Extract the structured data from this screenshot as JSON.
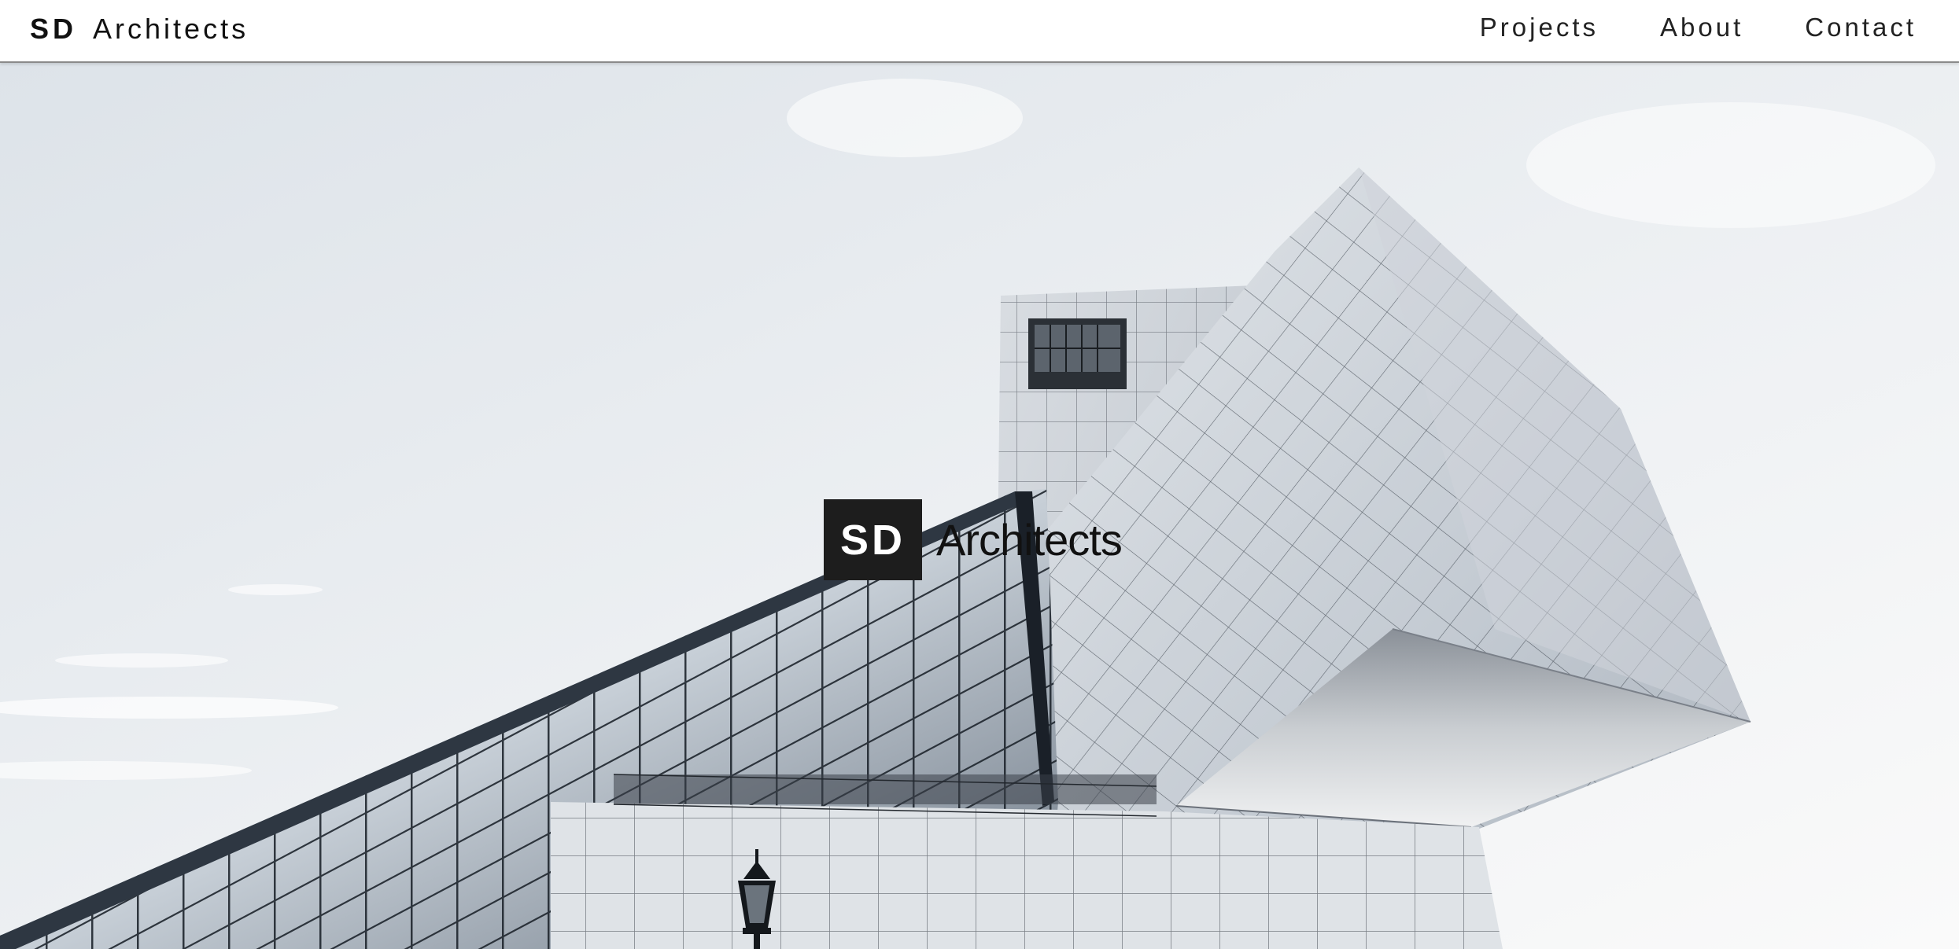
{
  "header": {
    "brand_bold": "SD",
    "brand_rest": "Architects",
    "nav": [
      {
        "label": "Projects"
      },
      {
        "label": "About"
      },
      {
        "label": "Contact"
      }
    ]
  },
  "hero": {
    "logo_box": "SD",
    "logo_text": "Architects",
    "image": "modern-architecture-building-photo"
  }
}
